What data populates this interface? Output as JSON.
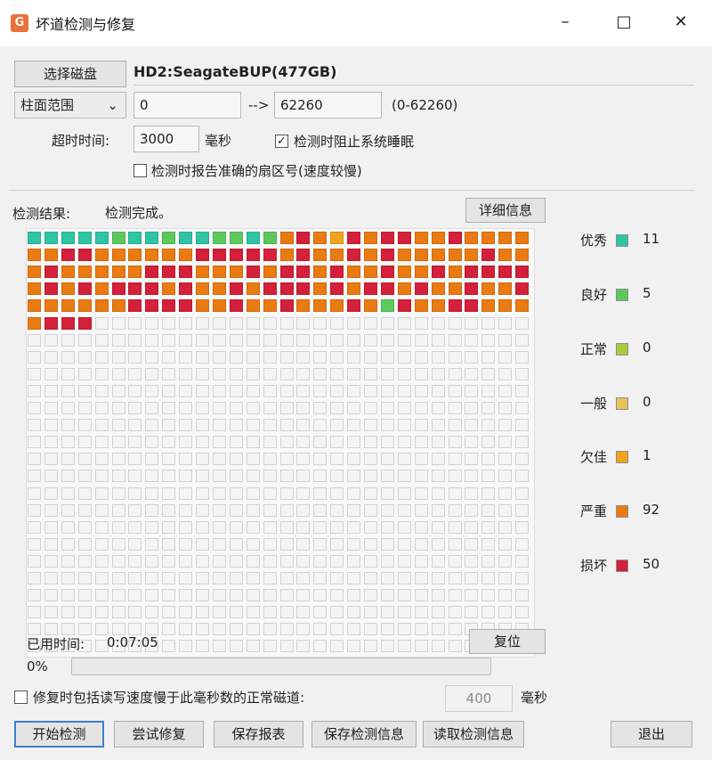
{
  "window": {
    "title": "坏道检测与修复",
    "controls": [
      "minimize-icon",
      "maximize-icon",
      "close-icon"
    ]
  },
  "toolbar": {
    "select_disk_label": "选择磁盘",
    "disk_name": "HD2:SeagateBUP(477GB)",
    "range_mode": "柱面范围",
    "range_start": "0",
    "range_arrow": "-->",
    "range_end": "62260",
    "range_limits": "(0-62260)",
    "timeout_label": "超时时间:",
    "timeout_value": "3000",
    "timeout_unit": "毫秒",
    "prevent_sleep_label": "检测时阻止系统睡眠",
    "prevent_sleep_checked": true,
    "report_sector_label": "检测时报告准确的扇区号(速度较慢)",
    "report_sector_checked": false
  },
  "results": {
    "label": "检测结果:",
    "status": "检测完成。",
    "detail_button": "详细信息"
  },
  "scan_grid": {
    "columns": 30,
    "rows": 25,
    "cells": [
      "A",
      "A",
      "A",
      "A",
      "A",
      "B",
      "A",
      "A",
      "B",
      "A",
      "A",
      "B",
      "B",
      "A",
      "B",
      "S",
      "D",
      "S",
      "W",
      "D",
      "S",
      "D",
      "D",
      "S",
      "S",
      "D",
      "S",
      "S",
      "S",
      "S",
      "S",
      "S",
      "D",
      "D",
      "S",
      "S",
      "S",
      "S",
      "S",
      "S",
      "D",
      "D",
      "D",
      "D",
      "D",
      "S",
      "D",
      "S",
      "S",
      "D",
      "S",
      "D",
      "S",
      "S",
      "S",
      "S",
      "S",
      "D",
      "S",
      "S",
      "S",
      "D",
      "S",
      "S",
      "S",
      "S",
      "S",
      "D",
      "D",
      "D",
      "S",
      "S",
      "S",
      "D",
      "S",
      "D",
      "D",
      "S",
      "D",
      "S",
      "S",
      "D",
      "S",
      "S",
      "D",
      "S",
      "D",
      "D",
      "D",
      "D",
      "S",
      "D",
      "S",
      "D",
      "S",
      "D",
      "D",
      "D",
      "S",
      "D",
      "S",
      "S",
      "D",
      "S",
      "D",
      "D",
      "D",
      "S",
      "D",
      "S",
      "D",
      "D",
      "S",
      "D",
      "S",
      "S",
      "D",
      "S",
      "S",
      "D",
      "S",
      "S",
      "S",
      "S",
      "S",
      "S",
      "D",
      "D",
      "D",
      "D",
      "S",
      "S",
      "D",
      "S",
      "S",
      "D",
      "S",
      "S",
      "S",
      "D",
      "S",
      "B",
      "D",
      "S",
      "S",
      "D",
      "D",
      "S",
      "S",
      "S",
      "S",
      "D",
      "D",
      "D"
    ]
  },
  "legend": [
    {
      "label": "优秀",
      "count": "11",
      "color": "#2ec4a4"
    },
    {
      "label": "良好",
      "count": "5",
      "color": "#5dc95d"
    },
    {
      "label": "正常",
      "count": "0",
      "color": "#a9cc3c"
    },
    {
      "label": "一般",
      "count": "0",
      "color": "#e8c255"
    },
    {
      "label": "欠佳",
      "count": "1",
      "color": "#f2a21b"
    },
    {
      "label": "严重",
      "count": "92",
      "color": "#ea7a12"
    },
    {
      "label": "损坏",
      "count": "50",
      "color": "#d4203a"
    }
  ],
  "status": {
    "elapsed_label": "已用时间:",
    "elapsed_value": "0:07:05",
    "reset_button": "复位",
    "progress_text": "0%",
    "progress_value": 0
  },
  "repair": {
    "include_slow_label": "修复时包括读写速度慢于此毫秒数的正常磁道:",
    "include_slow_checked": false,
    "threshold_value": "400",
    "threshold_unit": "毫秒"
  },
  "actions": {
    "start": "开始检测",
    "try_repair": "尝试修复",
    "save_report": "保存报表",
    "save_info": "保存检测信息",
    "load_info": "读取检测信息",
    "exit": "退出"
  }
}
